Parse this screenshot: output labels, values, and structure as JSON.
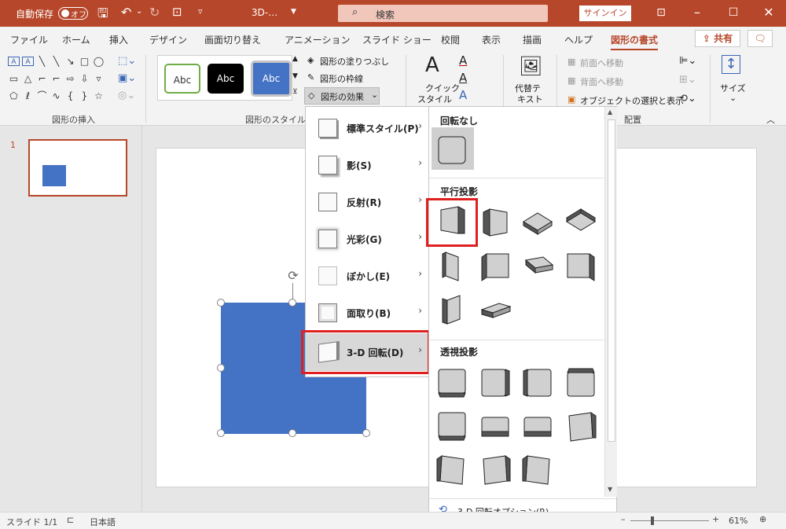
{
  "titlebar": {
    "autosave_label": "自動保存",
    "autosave_state": "オフ",
    "filename": "3D-…",
    "search_placeholder": "検索",
    "signin_label": "サインイン"
  },
  "tabs": [
    "ファイル",
    "ホーム",
    "挿入",
    "デザイン",
    "画面切り替え",
    "アニメーション",
    "スライド ショー",
    "校閲",
    "表示",
    "描画",
    "ヘルプ",
    "図形の書式"
  ],
  "share_label": "共有",
  "ribbon": {
    "insert_shapes_label": "図形の挿入",
    "shape_styles_label": "図形のスタイル",
    "style_thumb_text": "Abc",
    "fill_label": "図形の塗りつぶし",
    "outline_label": "図形の枠線",
    "effects_label": "図形の効果",
    "quick_style_line1": "クイック",
    "quick_style_line2": "スタイル",
    "alt_text_line1": "代替テ",
    "alt_text_line2": "キスト",
    "bring_forward": "前面へ移動",
    "send_backward": "背面へ移動",
    "selection_pane": "オブジェクトの選択と表示",
    "arrange_label": "配置",
    "size_label": "サイズ"
  },
  "slide_panel": {
    "number": "1"
  },
  "effects_menu": {
    "items": [
      {
        "label": "標準スタイル(P)"
      },
      {
        "label": "影(S)"
      },
      {
        "label": "反射(R)"
      },
      {
        "label": "光彩(G)"
      },
      {
        "label": "ぼかし(E)"
      },
      {
        "label": "面取り(B)"
      },
      {
        "label": "3-D 回転(D)"
      }
    ]
  },
  "gallery": {
    "no_rotation": "回転なし",
    "parallel": "平行投影",
    "perspective": "透視投影",
    "options_label": "3-D 回転オプション(R)..."
  },
  "status": {
    "slide_info": "スライド 1/1",
    "language": "日本語",
    "zoom": "61%"
  },
  "colors": {
    "accent": "#b7472a",
    "shape": "#4472c4",
    "highlight": "#e02020"
  }
}
